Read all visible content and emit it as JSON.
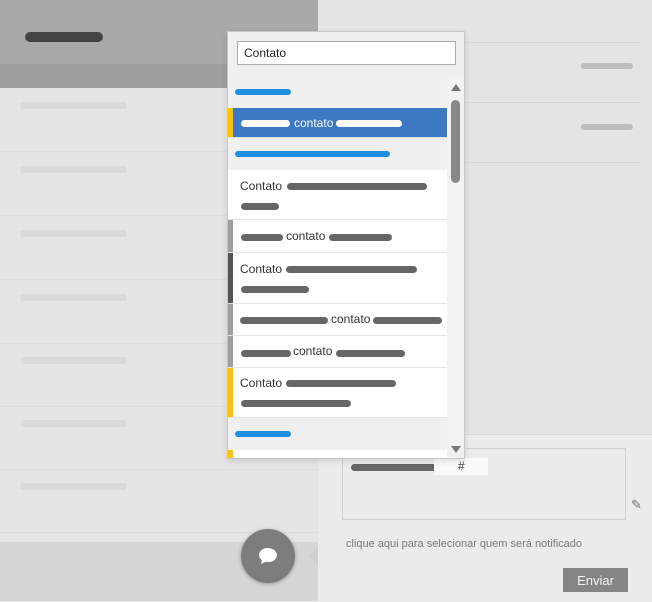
{
  "search": {
    "value": "Contato"
  },
  "options": [
    {
      "label": "contato"
    },
    {
      "label": "Contato"
    },
    {
      "label": "contato"
    },
    {
      "label": "Contato"
    },
    {
      "label": "contato"
    },
    {
      "label": "contato"
    },
    {
      "label": "Contato"
    }
  ],
  "composer": {
    "hash_symbol": "#",
    "notify_text": "clique aqui para selecionar quem será notificado",
    "send_label": "Enviar"
  },
  "colors": {
    "accent_blue": "#1e8fe1",
    "selected": "#3c78c3",
    "accent_yellow": "#ffc107",
    "accent_gray": "#9e9e9e",
    "accent_dark": "#555555"
  },
  "icons": {
    "chat": "chat-bubble-icon",
    "attach": "paperclip-icon"
  }
}
